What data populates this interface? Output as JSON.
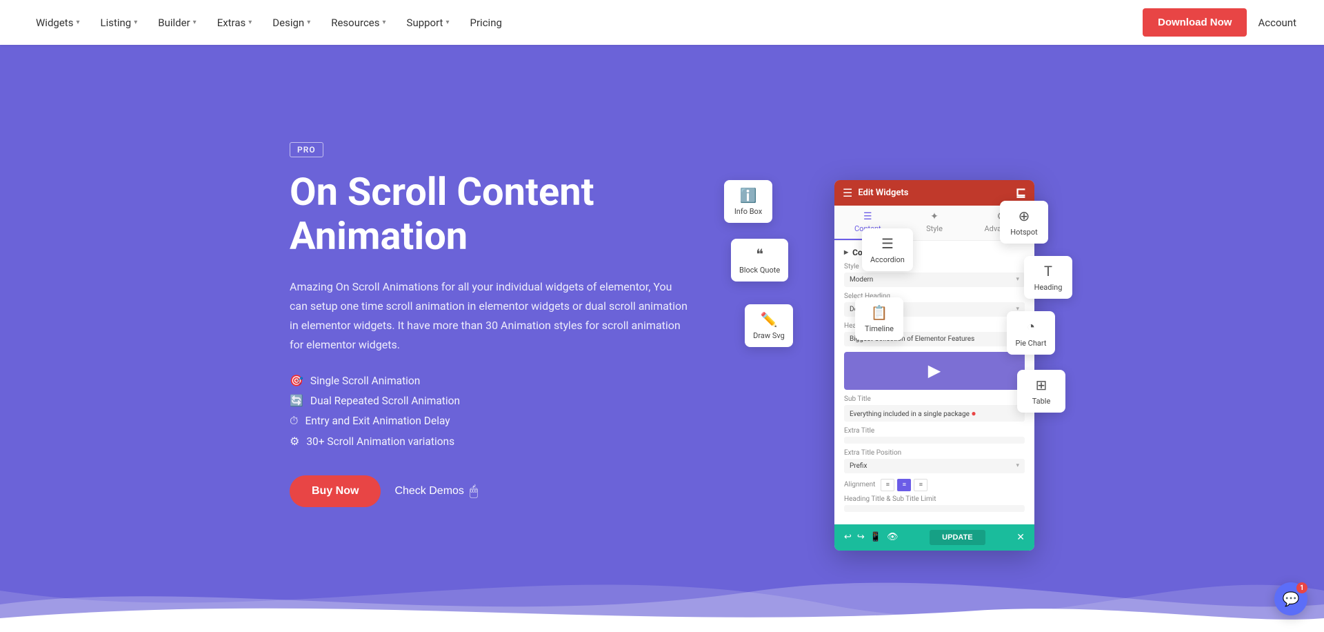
{
  "navbar": {
    "items": [
      {
        "label": "Widgets",
        "has_dropdown": true
      },
      {
        "label": "Listing",
        "has_dropdown": true
      },
      {
        "label": "Builder",
        "has_dropdown": true
      },
      {
        "label": "Extras",
        "has_dropdown": true
      },
      {
        "label": "Design",
        "has_dropdown": true
      },
      {
        "label": "Resources",
        "has_dropdown": true
      },
      {
        "label": "Support",
        "has_dropdown": true
      },
      {
        "label": "Pricing",
        "has_dropdown": false
      }
    ],
    "download_label": "Download Now",
    "account_label": "Account"
  },
  "hero": {
    "pro_badge": "PRO",
    "title": "On Scroll Content Animation",
    "description": "Amazing On Scroll Animations for all your individual widgets of elementor, You can setup one time scroll animation in elementor widgets or dual scroll animation in elementor widgets. It have more than 30 Animation styles for scroll animation for elementor widgets.",
    "features": [
      "Single Scroll Animation",
      "Dual Repeated Scroll Animation",
      "Entry and Exit Animation Delay",
      "30+ Scroll Animation variations"
    ],
    "buy_label": "Buy Now",
    "demos_label": "Check Demos"
  },
  "elementor_panel": {
    "title": "Edit Widgets",
    "tabs": [
      {
        "label": "Content",
        "icon": "☰"
      },
      {
        "label": "Style",
        "icon": "✦"
      },
      {
        "label": "Advanced",
        "icon": "⚙"
      }
    ],
    "section_title": "Content",
    "fields": {
      "style_label": "Style",
      "style_value": "Modern",
      "select_heading_label": "Select Heading",
      "select_heading_value": "Default",
      "heading_title_label": "Heading Title",
      "heading_title_value": "Biggest Collection of Elementor Features",
      "sub_title_label": "Sub Title",
      "sub_title_value": "Everything included in a single package",
      "extra_title_label": "Extra Title",
      "extra_title_value": "",
      "extra_title_position_label": "Extra Title Position",
      "extra_title_position_value": "Prefix",
      "alignment_label": "Alignment",
      "heading_title_sub_limit": "Heading Title & Sub Title Limit"
    },
    "update_label": "UPDATE"
  },
  "widgets": [
    {
      "name": "info-box",
      "label": "Info Box",
      "icon": "ℹ"
    },
    {
      "name": "block-quote",
      "label": "Block Quote",
      "icon": "❝"
    },
    {
      "name": "accordion",
      "label": "Accordion",
      "icon": "☰"
    },
    {
      "name": "draw-svg",
      "label": "Draw Svg",
      "icon": "✏"
    },
    {
      "name": "timeline",
      "label": "Timeline",
      "icon": "⊡"
    },
    {
      "name": "hotspot",
      "label": "Hotspot",
      "icon": "⊕"
    },
    {
      "name": "heading",
      "label": "Heading",
      "icon": "T"
    },
    {
      "name": "pie-chart",
      "label": "Pie Chart",
      "icon": "◔"
    },
    {
      "name": "table",
      "label": "Table",
      "icon": "⊞"
    }
  ],
  "chat": {
    "badge_count": "1"
  }
}
